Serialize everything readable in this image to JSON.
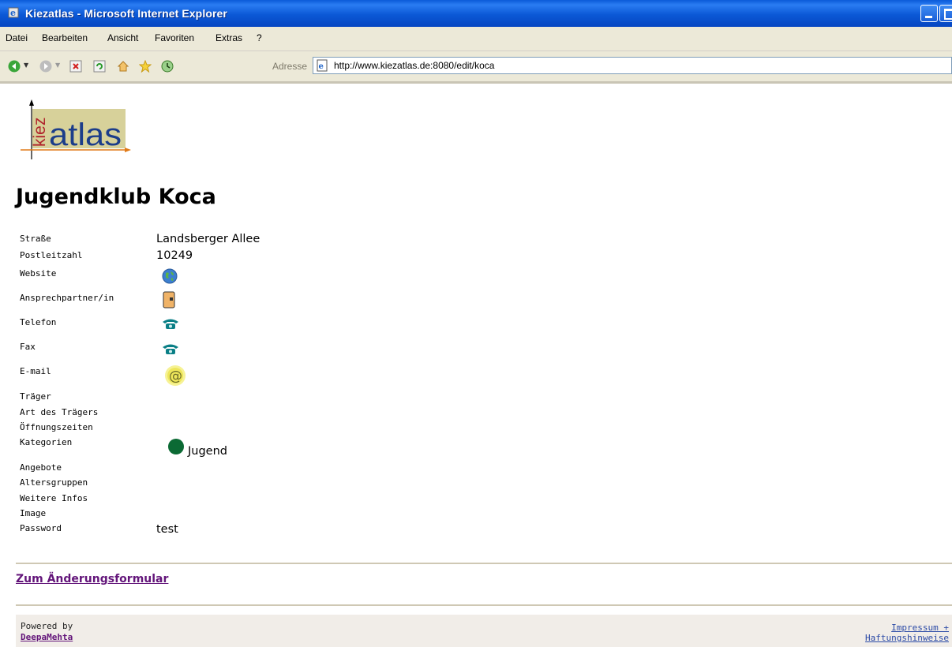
{
  "window": {
    "title": "Kiezatlas - Microsoft Internet Explorer"
  },
  "menu": [
    "Datei",
    "Bearbeiten",
    "Ansicht",
    "Favoriten",
    "Extras",
    "?"
  ],
  "toolbar": {
    "icons": [
      "back-icon",
      "forward-icon",
      "stop-icon",
      "refresh-icon",
      "home-icon",
      "favorites-star-icon",
      "history-icon"
    ],
    "address_label": "Adresse",
    "address_url": "http://www.kiezatlas.de:8080/edit/koca"
  },
  "logo": {
    "text_vertical": "kiez",
    "text_main": "atlas"
  },
  "page": {
    "heading": "Jugendklub Koca",
    "fields": {
      "strasse": {
        "label": "Straße",
        "value": "Landsberger Allee"
      },
      "plz": {
        "label": "Postleitzahl",
        "value": "10249"
      },
      "website": {
        "label": "Website",
        "icon": "globe-icon"
      },
      "ansprech": {
        "label": "Ansprechpartner/in",
        "icon": "contact-card-icon"
      },
      "telefon": {
        "label": "Telefon",
        "icon": "phone-icon"
      },
      "fax": {
        "label": "Fax",
        "icon": "phone-icon"
      },
      "email": {
        "label": "E-mail",
        "icon": "at-sign-icon"
      },
      "traeger": {
        "label": "Träger"
      },
      "art_traeger": {
        "label": "Art des Trägers"
      },
      "oeffnungszeiten": {
        "label": "Öffnungszeiten"
      },
      "kategorien": {
        "label": "Kategorien",
        "value": "Jugend",
        "color": "#0b6a34"
      },
      "angebote": {
        "label": "Angebote"
      },
      "altersgruppen": {
        "label": "Altersgruppen"
      },
      "weitere": {
        "label": "Weitere Infos"
      },
      "image": {
        "label": "Image"
      },
      "password": {
        "label": "Password",
        "value": "test"
      }
    },
    "edit_link": "Zum Änderungsformular"
  },
  "footer": {
    "powered_by": "Powered by",
    "deepamehta": "DeepaMehta",
    "impressum_line1": "Impressum +",
    "impressum_line2": "Haftungshinweise"
  }
}
